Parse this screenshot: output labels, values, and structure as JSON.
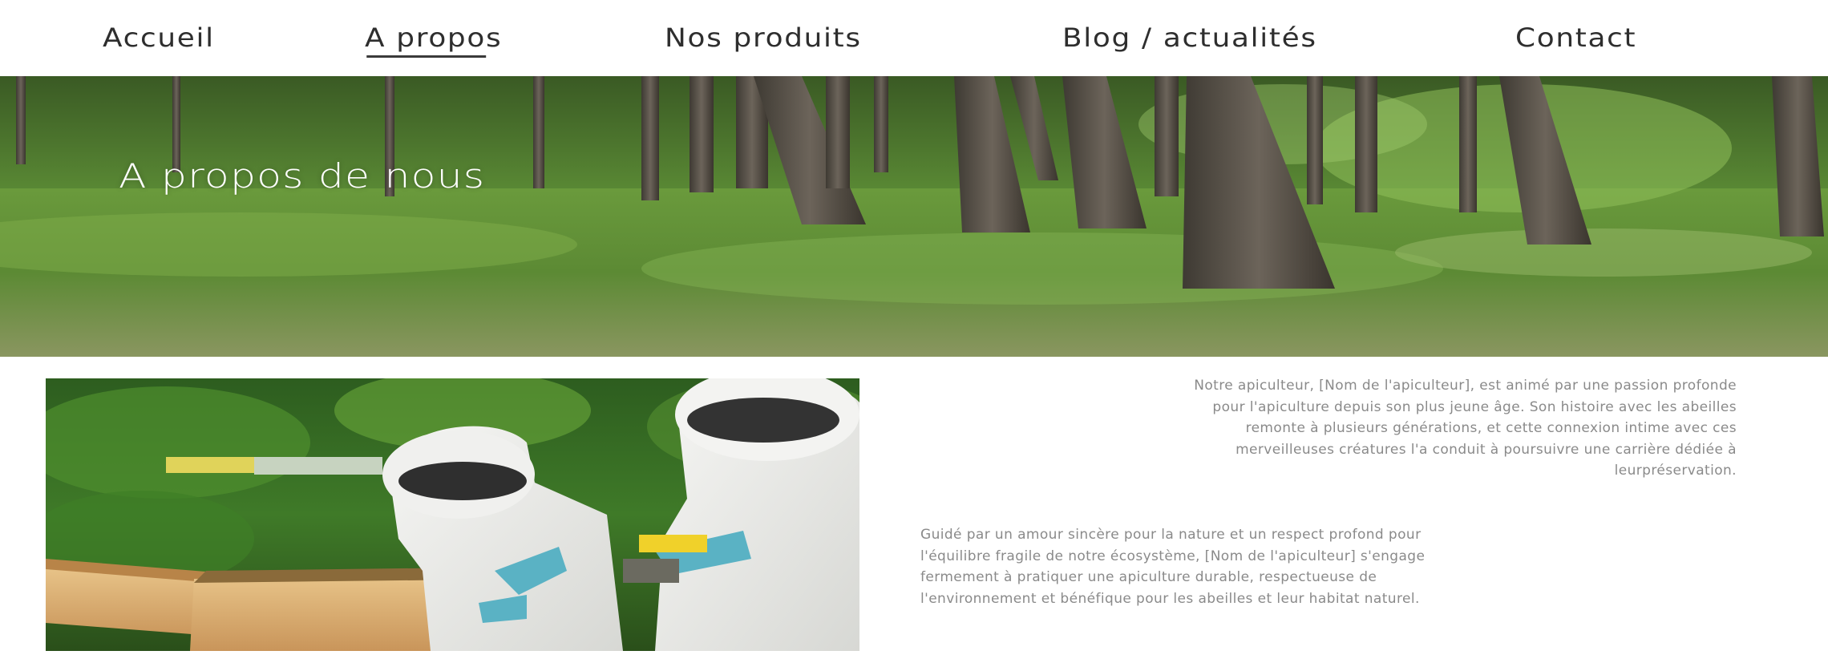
{
  "nav": {
    "items": [
      {
        "label": "Accueil"
      },
      {
        "label": "A propos",
        "active": true
      },
      {
        "label": "Nos produits"
      },
      {
        "label": "Blog / actualités"
      },
      {
        "label": "Contact"
      }
    ]
  },
  "hero": {
    "title": "A propos de nous"
  },
  "about": {
    "paragraph_1": "Notre apiculteur, [Nom de l'apiculteur], est animé par une passion profonde pour l'apiculture depuis son plus jeune âge. Son histoire avec les abeilles remonte à plusieurs générations, et cette connexion intime avec ces merveilleuses créatures l'a conduit à poursuivre une carrière dédiée à leurpréservation.",
    "paragraph_2": " Guidé par un amour sincère pour la nature et un respect profond pour l'équilibre fragile de notre écosystème, [Nom de l'apiculteur] s'engage fermement à pratiquer une apiculture durable, respectueuse de l'environnement et bénéfique pour les abeilles et leur habitat naturel."
  },
  "colors": {
    "nav_text": "#2e2e2e",
    "body_text": "#8a8a8a",
    "hero_text": "#ffffff"
  }
}
